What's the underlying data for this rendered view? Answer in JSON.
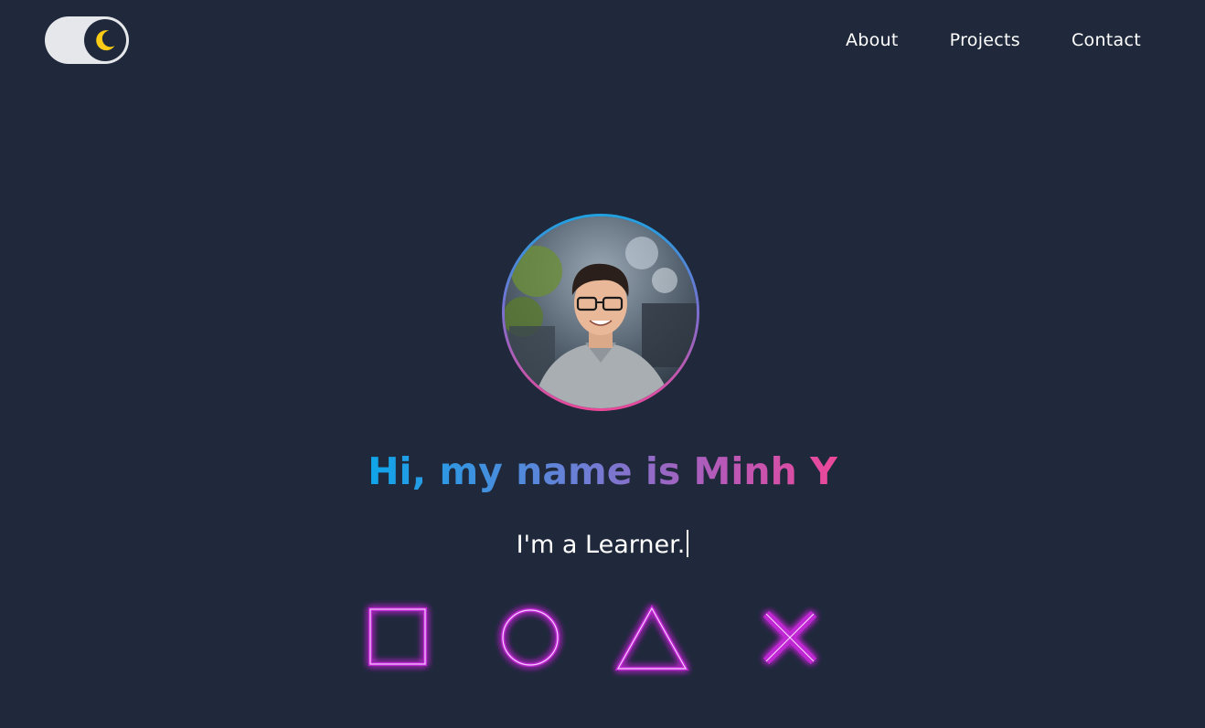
{
  "header": {
    "theme_toggle": {
      "mode": "dark",
      "icon": "moon-icon",
      "icon_color": "#facc15"
    },
    "nav": [
      {
        "label": "About"
      },
      {
        "label": "Projects"
      },
      {
        "label": "Contact"
      }
    ]
  },
  "hero": {
    "avatar_alt": "profile-photo",
    "title": "Hi, my name is Minh Y",
    "subtitle": "I'm a Learner.",
    "gradient_colors": [
      "#0ea5e9",
      "#6b7fd6",
      "#b659b8",
      "#ec4899"
    ]
  },
  "shapes": {
    "icons": [
      "square-icon",
      "circle-icon",
      "triangle-icon",
      "cross-icon"
    ],
    "glow_color": "#c026d3"
  },
  "colors": {
    "background": "#1f293b",
    "text": "#ffffff"
  }
}
